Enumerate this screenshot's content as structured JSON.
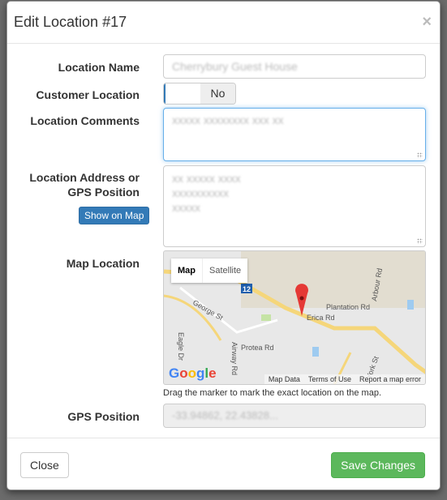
{
  "modal": {
    "title": "Edit Location #17",
    "close_glyph": "×"
  },
  "form": {
    "location_name_label": "Location Name",
    "location_name_value": "Cherrybury Guest House",
    "customer_location_label": "Customer Location",
    "customer_location_value": "No",
    "location_comments_label": "Location Comments",
    "location_comments_value": "xxxxx xxxxxxxx xxx xx",
    "address_label": "Location Address or GPS Position",
    "address_lines": [
      "xx xxxxx xxxx",
      "xxxxxxxxxx",
      "xxxxx"
    ],
    "show_on_map": "Show on Map",
    "map_location_label": "Map Location",
    "map": {
      "type_map": "Map",
      "type_satellite": "Satellite",
      "roads": [
        "George St",
        "Plantation Rd",
        "Erica Rd",
        "Arbour Rd",
        "Protea Rd",
        "Airway Rd",
        "Eagle Dr",
        "York St"
      ],
      "route": "12",
      "attribution": [
        "Map Data",
        "Terms of Use",
        "Report a map error"
      ],
      "marker_color": "#e53935"
    },
    "map_help": "Drag the marker to mark the exact location on the map.",
    "gps_label": "GPS Position",
    "gps_value": "-33.94862, 22.43828..."
  },
  "footer": {
    "close": "Close",
    "save": "Save Changes",
    "save_color": "#5cb85c"
  }
}
